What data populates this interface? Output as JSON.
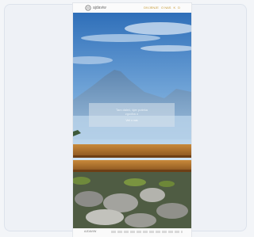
{
  "site": {
    "logo_text": "ajdaviw",
    "logo_icon": "swirl-logo-icon",
    "nav": [
      "DIVJENJE",
      "O NAS",
      "K",
      "D"
    ]
  },
  "hero": {
    "caption_title": "Tam daleč, kjer poteka",
    "caption_subtitle": "zgodba o",
    "caption_link": "Več o nas"
  },
  "footer": {
    "title": "AJDAVIW"
  },
  "colors": {
    "accent": "#c79a35",
    "sky_top": "#2f78c4",
    "sky_bottom": "#cfe3f4",
    "bench": "#b5762f"
  }
}
